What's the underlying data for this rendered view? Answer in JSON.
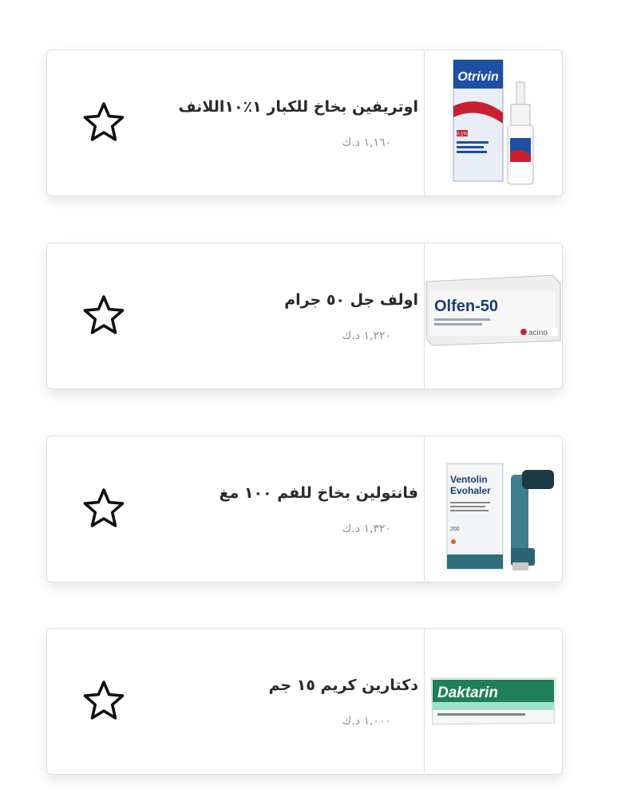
{
  "products": [
    {
      "name": "اوتريفين بخاخ للكبار ١٪١٠اللانف",
      "price": "١,١٦٠ د.ك",
      "image": "otrivin-spray-box",
      "image_text": [
        "Otrivin",
        "0.1%"
      ]
    },
    {
      "name": "اولف جل ٥٠ جرام",
      "price": "١,٢٢٠ د.ك",
      "image": "olfen-gel-box",
      "image_text": [
        "Olfen-50",
        "acino"
      ]
    },
    {
      "name": "فانتولين بخاخ للفم ١٠٠ مغ",
      "price": "١,٣٢٠ د.ك",
      "image": "ventolin-inhaler-box",
      "image_text": [
        "Ventolin",
        "Evohaler",
        "200"
      ]
    },
    {
      "name": "دكتارين كريم ١٥ جم",
      "price": "١,٠٠٠ د.ك",
      "image": "daktarin-cream-box",
      "image_text": [
        "Daktarin"
      ]
    }
  ],
  "favorite_icon": "star-outline-icon"
}
